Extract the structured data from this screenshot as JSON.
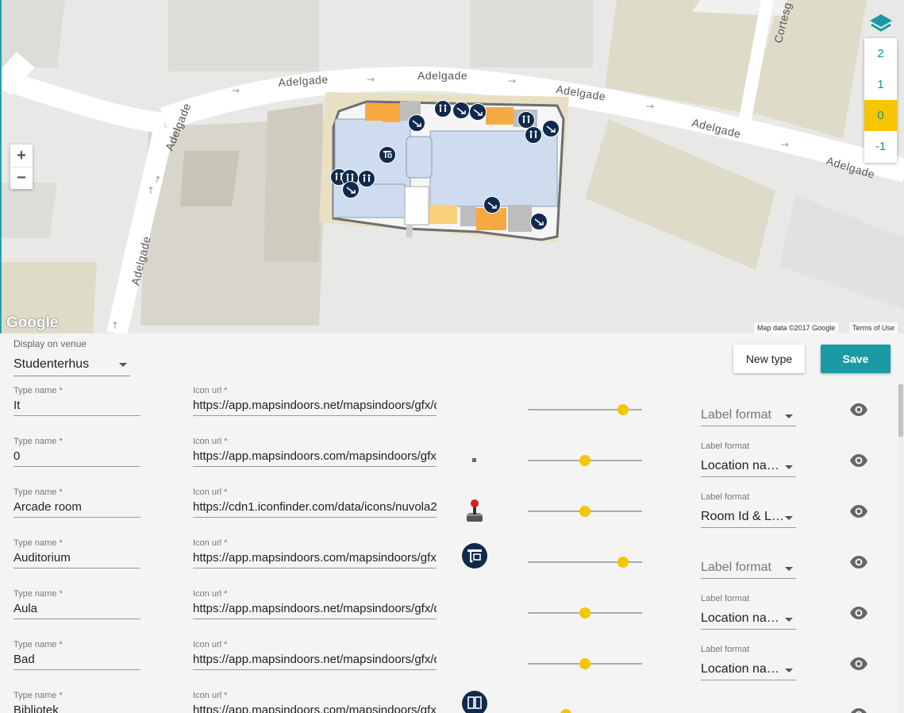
{
  "map": {
    "street_labels": [
      "Adelgade",
      "Adelgade",
      "Adelgade",
      "Adelgade",
      "Adelgade",
      "Adelgade",
      "Adelgade",
      "Cortesg"
    ],
    "google_logo": "Google",
    "attribution": "Map data ©2017 Google",
    "terms": "Terms of Use",
    "zoom_in": "+",
    "zoom_out": "−",
    "floors": [
      "2",
      "1",
      "0",
      "-1"
    ],
    "active_floor": "0",
    "colors": {
      "accent": "#1a9aa3",
      "active_floor": "#f6c500",
      "poi": "#0f2a4d"
    }
  },
  "toolbar": {
    "venue_label": "Display on venue",
    "venue_value": "Studenterhus",
    "new_type": "New type",
    "save": "Save"
  },
  "field_labels": {
    "type_name": "Type name *",
    "icon_url": "Icon url *",
    "label_format": "Label format"
  },
  "rows": [
    {
      "type_name": "It",
      "icon_url": "https://app.mapsindoors.net/mapsindoors/gfx/de",
      "icon": "none",
      "slider": 0.83,
      "label_format": "",
      "placeholder": "Label format"
    },
    {
      "type_name": "0",
      "icon_url": "https://app.mapsindoors.com/mapsindoors/gfx/c",
      "icon": "small-square",
      "slider": 0.5,
      "label_format": "Location na…",
      "placeholder": ""
    },
    {
      "type_name": "Arcade room",
      "icon_url": "https://cdn1.iconfinder.com/data/icons/nuvola2/",
      "icon": "joystick",
      "slider": 0.5,
      "label_format": "Room Id & L…",
      "placeholder": ""
    },
    {
      "type_name": "Auditorium",
      "icon_url": "https://app.mapsindoors.com/mapsindoors/gfx/a",
      "icon": "auditorium",
      "slider": 0.83,
      "label_format": "",
      "placeholder": "Label format"
    },
    {
      "type_name": "Aula",
      "icon_url": "https://app.mapsindoors.net/mapsindoors/gfx/de",
      "icon": "none",
      "slider": 0.5,
      "label_format": "Location na…",
      "placeholder": ""
    },
    {
      "type_name": "Bad",
      "icon_url": "https://app.mapsindoors.net/mapsindoors/gfx/de",
      "icon": "none",
      "slider": 0.5,
      "label_format": "Location na…",
      "placeholder": ""
    },
    {
      "type_name": "Bibliotek",
      "icon_url": "https://app.mapsindoors.com/mapsindoors/gfx/a",
      "icon": "library",
      "slider": 0.33,
      "label_format": "",
      "placeholder": ""
    }
  ]
}
